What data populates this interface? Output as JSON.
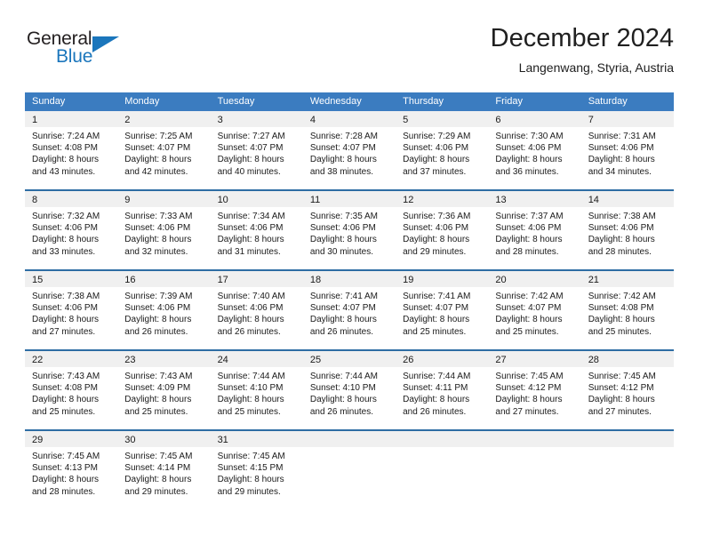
{
  "brand": {
    "name_part1": "General",
    "name_part2": "Blue",
    "triangle_icon": "triangle-icon",
    "color_dark": "#231f20",
    "color_blue": "#1b76bc"
  },
  "header": {
    "title": "December 2024",
    "subtitle": "Langenwang, Styria, Austria"
  },
  "theme": {
    "header_bar": "#3b7cc0",
    "row_divider": "#2e6da4",
    "daynum_band": "#f0f0f0",
    "text": "#1a1a1a"
  },
  "calendar": {
    "weekday_headers": [
      "Sunday",
      "Monday",
      "Tuesday",
      "Wednesday",
      "Thursday",
      "Friday",
      "Saturday"
    ],
    "weeks": [
      [
        {
          "day": "1",
          "sunrise": "Sunrise: 7:24 AM",
          "sunset": "Sunset: 4:08 PM",
          "daylight_1": "Daylight: 8 hours",
          "daylight_2": "and 43 minutes."
        },
        {
          "day": "2",
          "sunrise": "Sunrise: 7:25 AM",
          "sunset": "Sunset: 4:07 PM",
          "daylight_1": "Daylight: 8 hours",
          "daylight_2": "and 42 minutes."
        },
        {
          "day": "3",
          "sunrise": "Sunrise: 7:27 AM",
          "sunset": "Sunset: 4:07 PM",
          "daylight_1": "Daylight: 8 hours",
          "daylight_2": "and 40 minutes."
        },
        {
          "day": "4",
          "sunrise": "Sunrise: 7:28 AM",
          "sunset": "Sunset: 4:07 PM",
          "daylight_1": "Daylight: 8 hours",
          "daylight_2": "and 38 minutes."
        },
        {
          "day": "5",
          "sunrise": "Sunrise: 7:29 AM",
          "sunset": "Sunset: 4:06 PM",
          "daylight_1": "Daylight: 8 hours",
          "daylight_2": "and 37 minutes."
        },
        {
          "day": "6",
          "sunrise": "Sunrise: 7:30 AM",
          "sunset": "Sunset: 4:06 PM",
          "daylight_1": "Daylight: 8 hours",
          "daylight_2": "and 36 minutes."
        },
        {
          "day": "7",
          "sunrise": "Sunrise: 7:31 AM",
          "sunset": "Sunset: 4:06 PM",
          "daylight_1": "Daylight: 8 hours",
          "daylight_2": "and 34 minutes."
        }
      ],
      [
        {
          "day": "8",
          "sunrise": "Sunrise: 7:32 AM",
          "sunset": "Sunset: 4:06 PM",
          "daylight_1": "Daylight: 8 hours",
          "daylight_2": "and 33 minutes."
        },
        {
          "day": "9",
          "sunrise": "Sunrise: 7:33 AM",
          "sunset": "Sunset: 4:06 PM",
          "daylight_1": "Daylight: 8 hours",
          "daylight_2": "and 32 minutes."
        },
        {
          "day": "10",
          "sunrise": "Sunrise: 7:34 AM",
          "sunset": "Sunset: 4:06 PM",
          "daylight_1": "Daylight: 8 hours",
          "daylight_2": "and 31 minutes."
        },
        {
          "day": "11",
          "sunrise": "Sunrise: 7:35 AM",
          "sunset": "Sunset: 4:06 PM",
          "daylight_1": "Daylight: 8 hours",
          "daylight_2": "and 30 minutes."
        },
        {
          "day": "12",
          "sunrise": "Sunrise: 7:36 AM",
          "sunset": "Sunset: 4:06 PM",
          "daylight_1": "Daylight: 8 hours",
          "daylight_2": "and 29 minutes."
        },
        {
          "day": "13",
          "sunrise": "Sunrise: 7:37 AM",
          "sunset": "Sunset: 4:06 PM",
          "daylight_1": "Daylight: 8 hours",
          "daylight_2": "and 28 minutes."
        },
        {
          "day": "14",
          "sunrise": "Sunrise: 7:38 AM",
          "sunset": "Sunset: 4:06 PM",
          "daylight_1": "Daylight: 8 hours",
          "daylight_2": "and 28 minutes."
        }
      ],
      [
        {
          "day": "15",
          "sunrise": "Sunrise: 7:38 AM",
          "sunset": "Sunset: 4:06 PM",
          "daylight_1": "Daylight: 8 hours",
          "daylight_2": "and 27 minutes."
        },
        {
          "day": "16",
          "sunrise": "Sunrise: 7:39 AM",
          "sunset": "Sunset: 4:06 PM",
          "daylight_1": "Daylight: 8 hours",
          "daylight_2": "and 26 minutes."
        },
        {
          "day": "17",
          "sunrise": "Sunrise: 7:40 AM",
          "sunset": "Sunset: 4:06 PM",
          "daylight_1": "Daylight: 8 hours",
          "daylight_2": "and 26 minutes."
        },
        {
          "day": "18",
          "sunrise": "Sunrise: 7:41 AM",
          "sunset": "Sunset: 4:07 PM",
          "daylight_1": "Daylight: 8 hours",
          "daylight_2": "and 26 minutes."
        },
        {
          "day": "19",
          "sunrise": "Sunrise: 7:41 AM",
          "sunset": "Sunset: 4:07 PM",
          "daylight_1": "Daylight: 8 hours",
          "daylight_2": "and 25 minutes."
        },
        {
          "day": "20",
          "sunrise": "Sunrise: 7:42 AM",
          "sunset": "Sunset: 4:07 PM",
          "daylight_1": "Daylight: 8 hours",
          "daylight_2": "and 25 minutes."
        },
        {
          "day": "21",
          "sunrise": "Sunrise: 7:42 AM",
          "sunset": "Sunset: 4:08 PM",
          "daylight_1": "Daylight: 8 hours",
          "daylight_2": "and 25 minutes."
        }
      ],
      [
        {
          "day": "22",
          "sunrise": "Sunrise: 7:43 AM",
          "sunset": "Sunset: 4:08 PM",
          "daylight_1": "Daylight: 8 hours",
          "daylight_2": "and 25 minutes."
        },
        {
          "day": "23",
          "sunrise": "Sunrise: 7:43 AM",
          "sunset": "Sunset: 4:09 PM",
          "daylight_1": "Daylight: 8 hours",
          "daylight_2": "and 25 minutes."
        },
        {
          "day": "24",
          "sunrise": "Sunrise: 7:44 AM",
          "sunset": "Sunset: 4:10 PM",
          "daylight_1": "Daylight: 8 hours",
          "daylight_2": "and 25 minutes."
        },
        {
          "day": "25",
          "sunrise": "Sunrise: 7:44 AM",
          "sunset": "Sunset: 4:10 PM",
          "daylight_1": "Daylight: 8 hours",
          "daylight_2": "and 26 minutes."
        },
        {
          "day": "26",
          "sunrise": "Sunrise: 7:44 AM",
          "sunset": "Sunset: 4:11 PM",
          "daylight_1": "Daylight: 8 hours",
          "daylight_2": "and 26 minutes."
        },
        {
          "day": "27",
          "sunrise": "Sunrise: 7:45 AM",
          "sunset": "Sunset: 4:12 PM",
          "daylight_1": "Daylight: 8 hours",
          "daylight_2": "and 27 minutes."
        },
        {
          "day": "28",
          "sunrise": "Sunrise: 7:45 AM",
          "sunset": "Sunset: 4:12 PM",
          "daylight_1": "Daylight: 8 hours",
          "daylight_2": "and 27 minutes."
        }
      ],
      [
        {
          "day": "29",
          "sunrise": "Sunrise: 7:45 AM",
          "sunset": "Sunset: 4:13 PM",
          "daylight_1": "Daylight: 8 hours",
          "daylight_2": "and 28 minutes."
        },
        {
          "day": "30",
          "sunrise": "Sunrise: 7:45 AM",
          "sunset": "Sunset: 4:14 PM",
          "daylight_1": "Daylight: 8 hours",
          "daylight_2": "and 29 minutes."
        },
        {
          "day": "31",
          "sunrise": "Sunrise: 7:45 AM",
          "sunset": "Sunset: 4:15 PM",
          "daylight_1": "Daylight: 8 hours",
          "daylight_2": "and 29 minutes."
        },
        {
          "day": "",
          "sunrise": "",
          "sunset": "",
          "daylight_1": "",
          "daylight_2": ""
        },
        {
          "day": "",
          "sunrise": "",
          "sunset": "",
          "daylight_1": "",
          "daylight_2": ""
        },
        {
          "day": "",
          "sunrise": "",
          "sunset": "",
          "daylight_1": "",
          "daylight_2": ""
        },
        {
          "day": "",
          "sunrise": "",
          "sunset": "",
          "daylight_1": "",
          "daylight_2": ""
        }
      ]
    ]
  }
}
